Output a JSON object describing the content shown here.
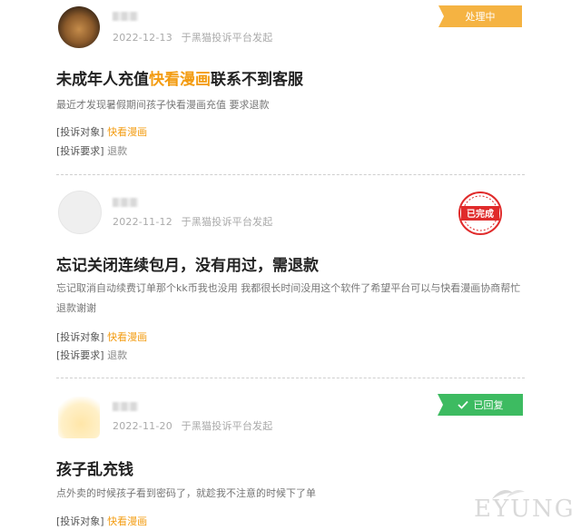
{
  "complaints": [
    {
      "date": "2022-12-13",
      "source": "于黑猫投诉平台发起",
      "status": "处理中",
      "title_before": "未成年人充值",
      "title_highlight": "快看漫画",
      "title_after": "联系不到客服",
      "description": "最近才发现暑假期间孩子快看漫画充值 要求退款",
      "target_label": "[投诉对象]",
      "target_value": "快看漫画",
      "request_label": "[投诉要求]",
      "request_value": "退款"
    },
    {
      "date": "2022-11-12",
      "source": "于黑猫投诉平台发起",
      "status": "已完成",
      "title": "忘记关闭连续包月，没有用过，需退款",
      "description": "忘记取消自动续费订单那个kk币我也没用 我都很长时间没用这个软件了希望平台可以与快看漫画协商帮忙退款谢谢",
      "target_label": "[投诉对象]",
      "target_value": "快看漫画",
      "request_label": "[投诉要求]",
      "request_value": "退款"
    },
    {
      "date": "2022-11-20",
      "source": "于黑猫投诉平台发起",
      "status": "已回复",
      "title": "孩子乱充钱",
      "description": "点外卖的时候孩子看到密码了，就趁我不注意的时候下了单",
      "target_label": "[投诉对象]",
      "target_value": "快看漫画"
    }
  ],
  "watermark": "EYUNG",
  "colors": {
    "highlight": "#f39c12",
    "processing": "#f5b342",
    "completed": "#e02b2b",
    "replied": "#3dbb61"
  },
  "icons": [
    "check-icon",
    "completed-stamp-icon"
  ]
}
